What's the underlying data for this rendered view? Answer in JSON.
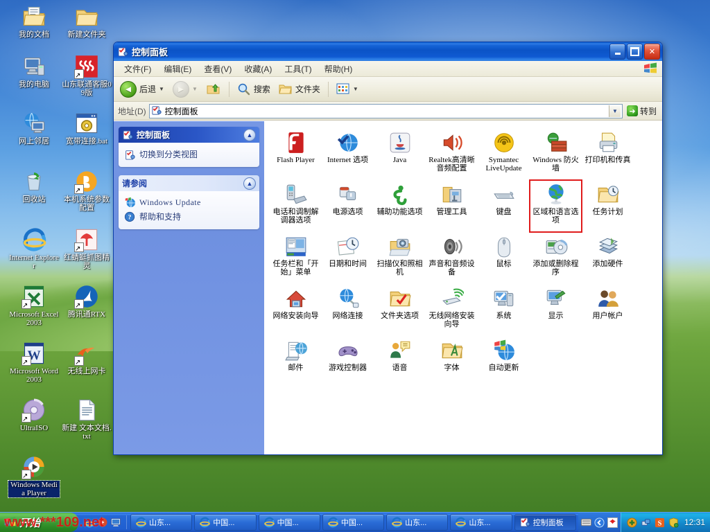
{
  "desktop": {
    "icons": [
      {
        "label": "我的文档",
        "icon": "my-documents-icon",
        "shortcut": false,
        "selected": false
      },
      {
        "label": "新建文件夹",
        "icon": "folder-icon",
        "shortcut": false,
        "selected": false
      },
      {
        "label": "我的电脑",
        "icon": "my-computer-icon",
        "shortcut": false,
        "selected": false
      },
      {
        "label": "山东联通客服09版",
        "icon": "unicom-app-icon",
        "shortcut": true,
        "selected": false
      },
      {
        "label": "网上邻居",
        "icon": "network-neighborhood-icon",
        "shortcut": false,
        "selected": false
      },
      {
        "label": "宽带连接.bat",
        "icon": "batch-file-icon",
        "shortcut": false,
        "selected": false
      },
      {
        "label": "回收站",
        "icon": "recycle-bin-icon",
        "shortcut": false,
        "selected": false
      },
      {
        "label": "本机系统参数配置",
        "icon": "baidu-b-icon",
        "shortcut": true,
        "selected": false
      },
      {
        "label": "Internet Explorer",
        "icon": "internet-explorer-icon",
        "shortcut": false,
        "selected": false
      },
      {
        "label": "红蜻蜓抓图精灵",
        "icon": "dragonfly-capture-icon",
        "shortcut": true,
        "selected": false
      },
      {
        "label": "Microsoft Excel 2003",
        "icon": "excel-icon",
        "shortcut": true,
        "selected": false
      },
      {
        "label": "腾讯通RTX",
        "icon": "rtx-icon",
        "shortcut": true,
        "selected": false
      },
      {
        "label": "Microsoft Word 2003",
        "icon": "word-icon",
        "shortcut": true,
        "selected": false
      },
      {
        "label": "无线上网卡",
        "icon": "wireless-card-icon",
        "shortcut": true,
        "selected": false
      },
      {
        "label": "UltraISO",
        "icon": "ultraiso-disc-icon",
        "shortcut": true,
        "selected": false
      },
      {
        "label": "新建 文本文档.txt",
        "icon": "text-file-icon",
        "shortcut": false,
        "selected": false
      },
      {
        "label": "Windows Media Player",
        "icon": "media-player-icon",
        "shortcut": true,
        "selected": true
      }
    ]
  },
  "window": {
    "title": "控制面板",
    "title_icon": "control-panel-icon",
    "buttons": {
      "minimize": "_",
      "maximize": "□",
      "close": "✕"
    },
    "menu": [
      "文件(F)",
      "编辑(E)",
      "查看(V)",
      "收藏(A)",
      "工具(T)",
      "帮助(H)"
    ],
    "toolbar": {
      "back": "后退",
      "forward": "",
      "up": "",
      "search": "搜索",
      "folders": "文件夹",
      "views": ""
    },
    "address": {
      "label": "地址(D)",
      "value": "控制面板",
      "go": "转到"
    }
  },
  "sidebar": {
    "panels": [
      {
        "title": "控制面板",
        "header_icon": "control-panel-icon",
        "links": [
          {
            "label": "切换到分类视图",
            "icon": "category-view-icon",
            "mono": false
          }
        ]
      },
      {
        "title": "请参阅",
        "header_icon": "",
        "links": [
          {
            "label": "Windows Update",
            "icon": "windows-update-icon",
            "mono": true
          },
          {
            "label": "帮助和支持",
            "icon": "help-support-icon",
            "mono": false
          }
        ]
      }
    ]
  },
  "control_panel_items": [
    {
      "label": "Flash Player",
      "icon": "flash-player-icon",
      "selected": false
    },
    {
      "label": "Internet 选项",
      "icon": "internet-options-icon",
      "selected": false
    },
    {
      "label": "Java",
      "icon": "java-icon",
      "selected": false
    },
    {
      "label": "Realtek高清晰音频配置",
      "icon": "realtek-audio-icon",
      "selected": false
    },
    {
      "label": "Symantec LiveUpdate",
      "icon": "symantec-liveupdate-icon",
      "selected": false
    },
    {
      "label": "Windows 防火墙",
      "icon": "windows-firewall-icon",
      "selected": false
    },
    {
      "label": "打印机和传真",
      "icon": "printers-faxes-icon",
      "selected": false
    },
    {
      "label": "电话和调制解调器选项",
      "icon": "phone-modem-icon",
      "selected": false
    },
    {
      "label": "电源选项",
      "icon": "power-options-icon",
      "selected": false
    },
    {
      "label": "辅助功能选项",
      "icon": "accessibility-icon",
      "selected": false
    },
    {
      "label": "管理工具",
      "icon": "admin-tools-icon",
      "selected": false
    },
    {
      "label": "键盘",
      "icon": "keyboard-icon",
      "selected": false
    },
    {
      "label": "区域和语言选项",
      "icon": "regional-language-icon",
      "selected": true
    },
    {
      "label": "任务计划",
      "icon": "scheduled-tasks-icon",
      "selected": false
    },
    {
      "label": "任务栏和「开始」菜单",
      "icon": "taskbar-startmenu-icon",
      "selected": false
    },
    {
      "label": "日期和时间",
      "icon": "date-time-icon",
      "selected": false
    },
    {
      "label": "扫描仪和照相机",
      "icon": "scanners-cameras-icon",
      "selected": false
    },
    {
      "label": "声音和音频设备",
      "icon": "sounds-audio-icon",
      "selected": false
    },
    {
      "label": "鼠标",
      "icon": "mouse-icon",
      "selected": false
    },
    {
      "label": "添加或删除程序",
      "icon": "add-remove-programs-icon",
      "selected": false
    },
    {
      "label": "添加硬件",
      "icon": "add-hardware-icon",
      "selected": false
    },
    {
      "label": "网络安装向导",
      "icon": "network-setup-wizard-icon",
      "selected": false
    },
    {
      "label": "网络连接",
      "icon": "network-connections-icon",
      "selected": false
    },
    {
      "label": "文件夹选项",
      "icon": "folder-options-icon",
      "selected": false
    },
    {
      "label": "无线网络安装向导",
      "icon": "wireless-network-wizard-icon",
      "selected": false
    },
    {
      "label": "系统",
      "icon": "system-icon",
      "selected": false
    },
    {
      "label": "显示",
      "icon": "display-icon",
      "selected": false
    },
    {
      "label": "用户帐户",
      "icon": "user-accounts-icon",
      "selected": false
    },
    {
      "label": "邮件",
      "icon": "mail-icon",
      "selected": false
    },
    {
      "label": "游戏控制器",
      "icon": "game-controllers-icon",
      "selected": false
    },
    {
      "label": "语音",
      "icon": "speech-icon",
      "selected": false
    },
    {
      "label": "字体",
      "icon": "fonts-icon",
      "selected": false
    },
    {
      "label": "自动更新",
      "icon": "automatic-updates-icon",
      "selected": false
    }
  ],
  "taskbar": {
    "start_label": "开始",
    "quick_launch": [
      "ie-icon",
      "media-icon",
      "desktop-icon"
    ],
    "tasks": [
      {
        "label": "山东...",
        "icon": "ie-icon",
        "active": false
      },
      {
        "label": "中国...",
        "icon": "ie-icon",
        "active": false
      },
      {
        "label": "中国...",
        "icon": "ie-icon",
        "active": false
      },
      {
        "label": "中国...",
        "icon": "ie-icon",
        "active": false
      },
      {
        "label": "山东...",
        "icon": "ie-icon",
        "active": false
      },
      {
        "label": "山东...",
        "icon": "ie-icon",
        "active": false
      },
      {
        "label": "控制面板",
        "icon": "control-panel-icon",
        "active": true
      }
    ],
    "ime": [
      "keyboard-icon",
      "ime-chevron-icon",
      "ime-red-icon"
    ],
    "tray": [
      "green-plus-icon",
      "blue-network-icon",
      "orange-s-icon",
      "shield-icon"
    ],
    "clock": "12:31"
  },
  "watermark": {
    "text": "www.***109.net"
  }
}
